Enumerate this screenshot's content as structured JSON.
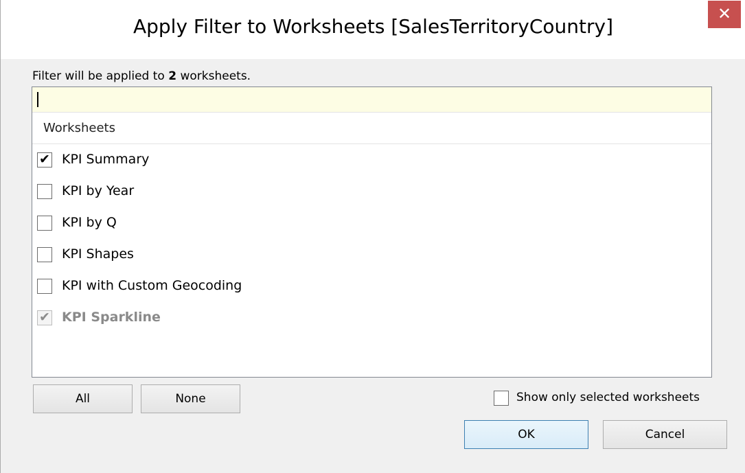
{
  "dialog": {
    "title": "Apply Filter to Worksheets [SalesTerritoryCountry]",
    "close_glyph": "✕"
  },
  "info": {
    "prefix": "Filter will be applied to ",
    "count": "2",
    "suffix": " worksheets."
  },
  "search": {
    "value": "",
    "placeholder": ""
  },
  "list": {
    "header": "Worksheets",
    "items": [
      {
        "label": "KPI Summary",
        "checked": true,
        "disabled": false
      },
      {
        "label": "KPI by Year",
        "checked": false,
        "disabled": false
      },
      {
        "label": "KPI by Q",
        "checked": false,
        "disabled": false
      },
      {
        "label": "KPI Shapes",
        "checked": false,
        "disabled": false
      },
      {
        "label": "KPI with Custom Geocoding",
        "checked": false,
        "disabled": false
      },
      {
        "label": "KPI Sparkline",
        "checked": true,
        "disabled": true
      }
    ]
  },
  "buttons": {
    "all": "All",
    "none": "None",
    "ok": "OK",
    "cancel": "Cancel"
  },
  "show_only": {
    "label": "Show only selected worksheets",
    "checked": false
  },
  "colors": {
    "close_bg": "#c7504f",
    "search_bg": "#fdfde4",
    "default_button_border": "#3c7fb1"
  }
}
